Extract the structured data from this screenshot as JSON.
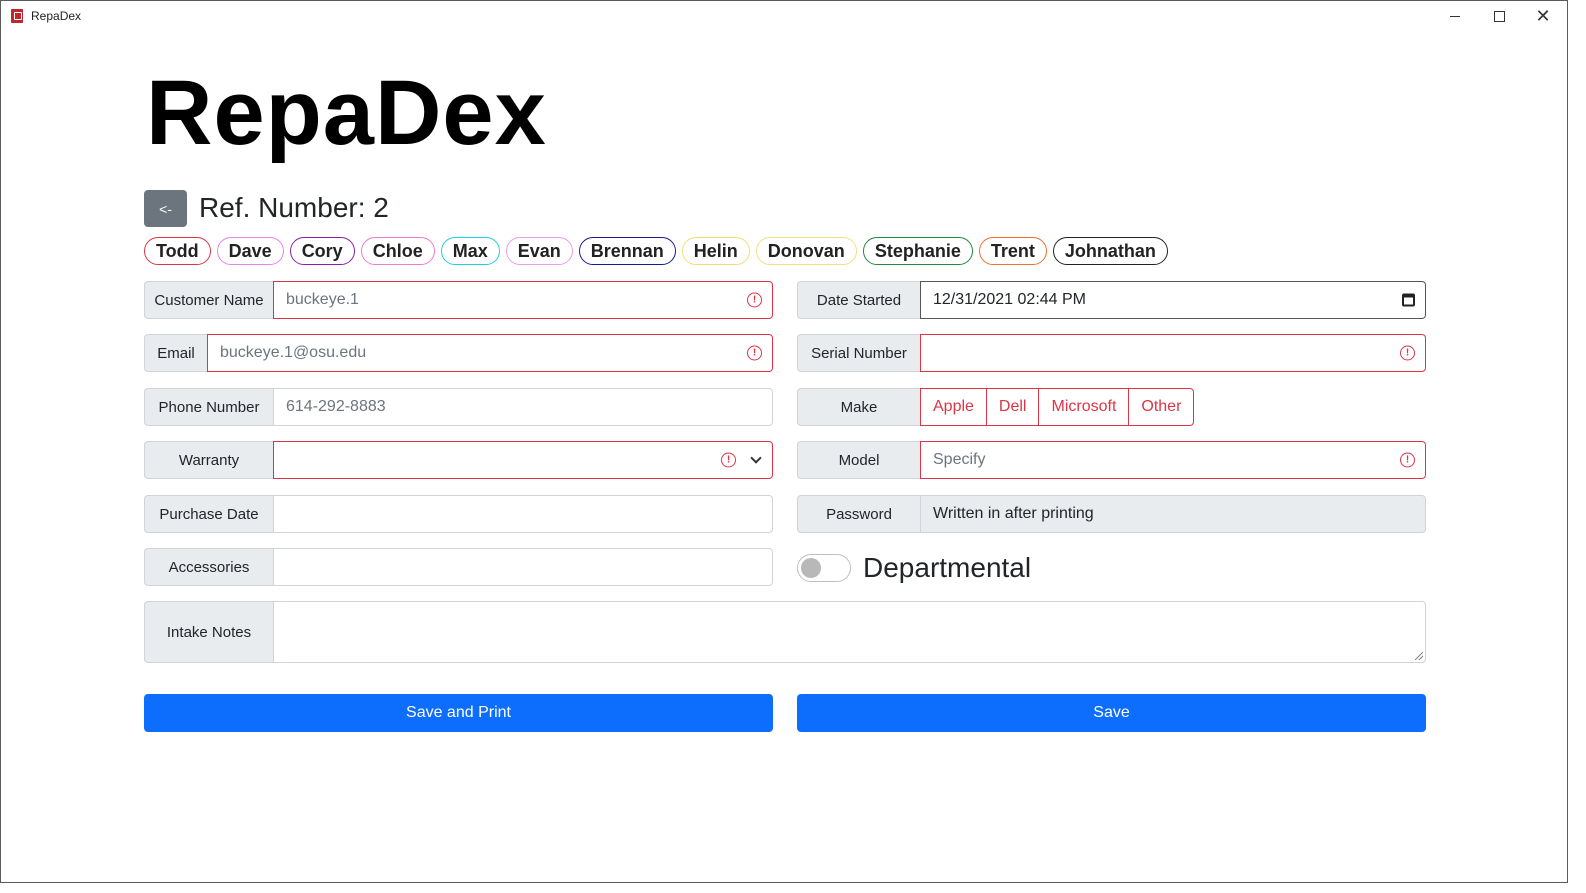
{
  "window": {
    "title": "RepaDex",
    "controls": {
      "minimize": "",
      "maximize": "",
      "close": "✕"
    }
  },
  "app_title": "RepaDex",
  "back_button": "<-",
  "ref_number": "Ref. Number: 2",
  "technicians": [
    {
      "name": "Todd",
      "color": "#dc3545"
    },
    {
      "name": "Dave",
      "color": "#e685e6"
    },
    {
      "name": "Cory",
      "color": "#8b1fa9"
    },
    {
      "name": "Chloe",
      "color": "#f07ad2"
    },
    {
      "name": "Max",
      "color": "#20d0e0"
    },
    {
      "name": "Evan",
      "color": "#e6a0e6"
    },
    {
      "name": "Brennan",
      "color": "#1a1a8c"
    },
    {
      "name": "Helin",
      "color": "#f0e070"
    },
    {
      "name": "Donovan",
      "color": "#f0e080"
    },
    {
      "name": "Stephanie",
      "color": "#1e8a3a"
    },
    {
      "name": "Trent",
      "color": "#f07030"
    },
    {
      "name": "Johnathan",
      "color": "#222222"
    }
  ],
  "form": {
    "customer_name": {
      "label": "Customer Name",
      "placeholder": "buckeye.1"
    },
    "email": {
      "label": "Email",
      "placeholder": "buckeye.1@osu.edu"
    },
    "phone": {
      "label": "Phone Number",
      "placeholder": "614-292-8883"
    },
    "warranty": {
      "label": "Warranty",
      "value": ""
    },
    "purchase_date": {
      "label": "Purchase Date",
      "value": ""
    },
    "accessories": {
      "label": "Accessories",
      "value": ""
    },
    "date_started": {
      "label": "Date Started",
      "value": "12/31/2021 02:44  PM"
    },
    "serial_number": {
      "label": "Serial Number",
      "value": ""
    },
    "make": {
      "label": "Make",
      "options": [
        "Apple",
        "Dell",
        "Microsoft",
        "Other"
      ]
    },
    "model": {
      "label": "Model",
      "placeholder": "Specify"
    },
    "password": {
      "label": "Password",
      "value": "Written in after printing"
    },
    "departmental": {
      "label": "Departmental",
      "checked": false
    },
    "intake_notes": {
      "label": "Intake Notes",
      "value": ""
    }
  },
  "buttons": {
    "save_and_print": "Save and Print",
    "save": "Save"
  },
  "colors": {
    "primary": "#0d6efd",
    "secondary": "#6c757d",
    "invalid": "#dc3545",
    "label_bg": "#e9ecef"
  }
}
